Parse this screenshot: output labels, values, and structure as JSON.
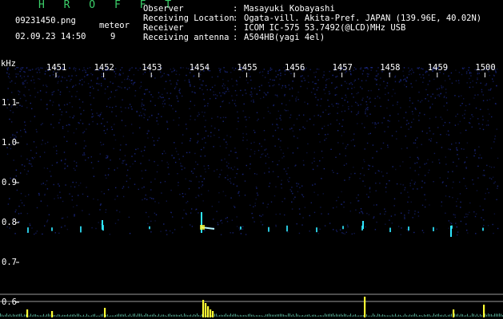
{
  "app": {
    "title": "H R O F F T"
  },
  "file": {
    "name": "09231450.png",
    "category": "meteor",
    "datetime": "02.09.23 14:50",
    "count": "9"
  },
  "meta": [
    {
      "label": "Observer",
      "sep": ":",
      "value": "Masayuki Kobayashi"
    },
    {
      "label": "Receiving Location",
      "sep": ":",
      "value": "Ogata-vill. Akita-Pref. JAPAN (139.96E, 40.02N)"
    },
    {
      "label": "Receiver",
      "sep": ":",
      "value": "ICOM IC-575 53.7492(@LCD)MHz USB"
    },
    {
      "label": "Receiving antenna",
      "sep": ":",
      "value": "A504HB(yagi 4el)"
    }
  ],
  "axis": {
    "unit": "kHz",
    "x_ticks": [
      "1451",
      "1452",
      "1453",
      "1454",
      "1455",
      "1456",
      "1457",
      "1458",
      "1459",
      "1500"
    ],
    "y_ticks": [
      "1.1",
      "1.0",
      "0.9",
      "0.8",
      "0.7",
      "0.6"
    ]
  },
  "colors": {
    "background": "#000000",
    "noise": "#1c2a8a",
    "echo": "#2fe6ff",
    "strong": "#ffff33",
    "trace": "#6fe0c0"
  }
}
